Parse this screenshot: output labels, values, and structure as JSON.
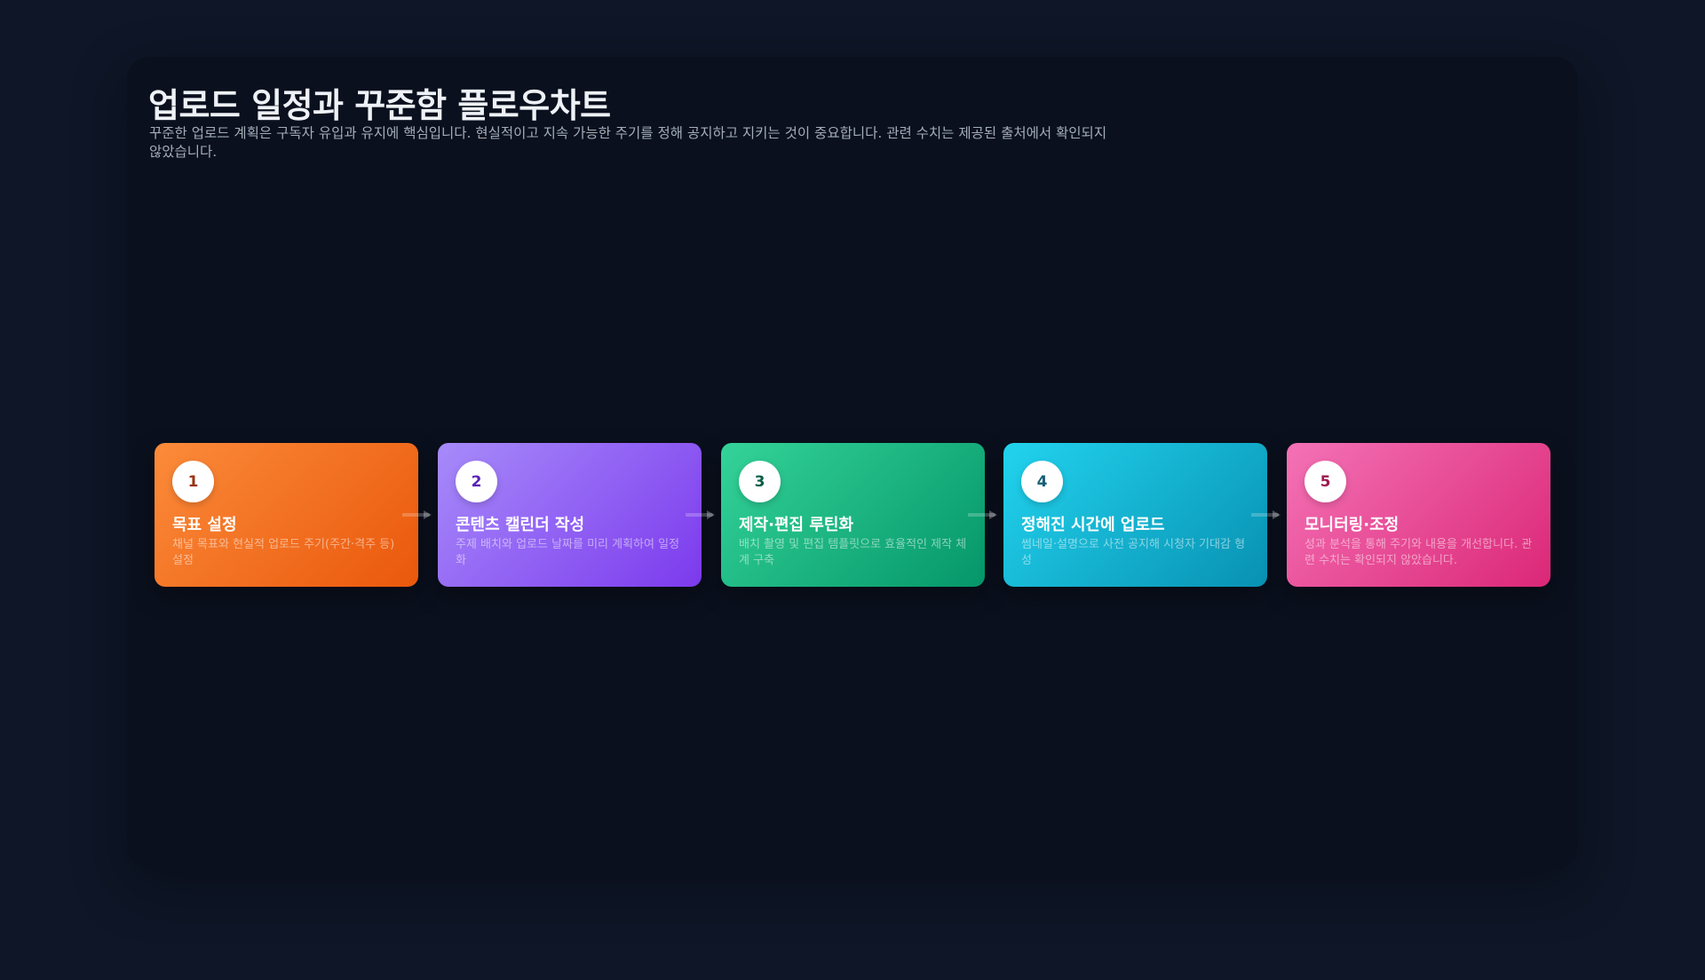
{
  "header": {
    "title": "업로드 일정과 꾸준함 플로우차트",
    "subtitle": "꾸준한 업로드 계획은 구독자 유입과 유지에 핵심입니다. 현실적이고 지속 가능한 주기를 정해 공지하고 지키는 것이 중요합니다. 관련 수치는 제공된 출처에서 확인되지 않았습니다."
  },
  "steps": [
    {
      "number": "1",
      "title": "목표 설정",
      "desc": "채널 목표와 현실적 업로드 주기(주간·격주 등) 설정",
      "color": "#ea580c"
    },
    {
      "number": "2",
      "title": "콘텐츠 캘린더 작성",
      "desc": "주제 배치와 업로드 날짜를 미리 계획하여 일정화",
      "color": "#7c3aed"
    },
    {
      "number": "3",
      "title": "제작·편집 루틴화",
      "desc": "배치 촬영 및 편집 템플릿으로 효율적인 제작 체계 구축",
      "color": "#059669"
    },
    {
      "number": "4",
      "title": "정해진 시간에 업로드",
      "desc": "썸네일·설명으로 사전 공지해 시청자 기대감 형성",
      "color": "#0891b2"
    },
    {
      "number": "5",
      "title": "모니터링·조정",
      "desc": "성과 분석을 통해 주기와 내용을 개선합니다. 관련 수치는 확인되지 않았습니다.",
      "color": "#db2777"
    }
  ],
  "icons": {
    "connector": "arrow-right-icon"
  }
}
